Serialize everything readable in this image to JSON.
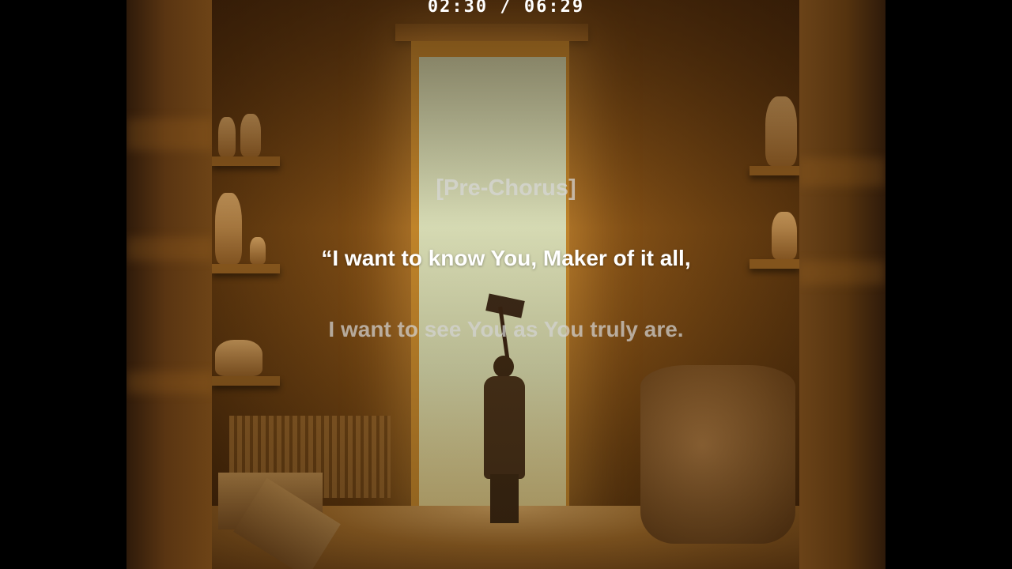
{
  "player": {
    "current_time": "02:30",
    "separator": "/",
    "duration": "06:29",
    "time_display": "02:30 / 06:29"
  },
  "lyrics": {
    "section": "[Pre-Chorus]",
    "current_line": "“I want to know You, Maker of it all,",
    "next_line": "I want to see You as You truly are."
  },
  "colors": {
    "background": "#000000",
    "lyric_active": "#ffffff",
    "lyric_inactive": "#d2d2d2",
    "artwork_glow": "#c88a2c"
  }
}
